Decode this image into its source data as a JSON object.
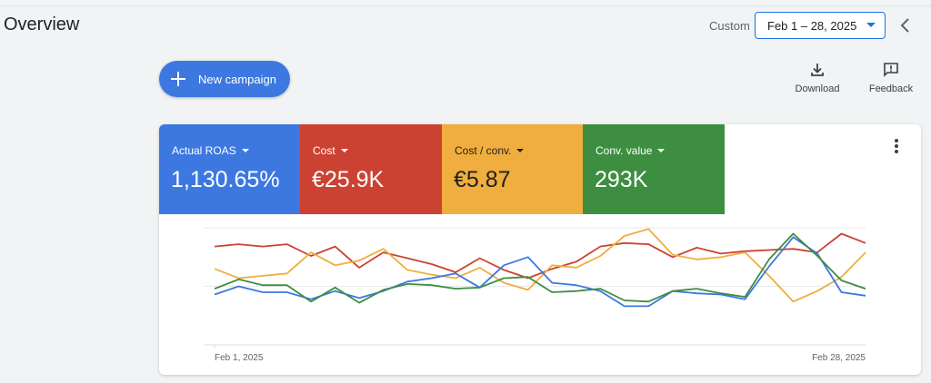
{
  "header": {
    "title": "Overview",
    "custom_label": "Custom",
    "date_range": "Feb 1 – 28, 2025"
  },
  "actions": {
    "new_campaign": "New campaign",
    "download": "Download",
    "feedback": "Feedback"
  },
  "metrics": [
    {
      "label": "Actual ROAS",
      "value": "1,130.65%",
      "color": "#3c78e0"
    },
    {
      "label": "Cost",
      "value": "€25.9K",
      "color": "#cc4232"
    },
    {
      "label": "Cost / conv.",
      "value": "€5.87",
      "color": "#efae3d"
    },
    {
      "label": "Conv. value",
      "value": "293K",
      "color": "#3e8e41"
    }
  ],
  "chart_data": {
    "type": "line",
    "x_tick_labels": [
      "Feb 1, 2025",
      "Feb 28, 2025"
    ],
    "x": [
      1,
      2,
      3,
      4,
      5,
      6,
      7,
      8,
      9,
      10,
      11,
      12,
      13,
      14,
      15,
      16,
      17,
      18,
      19,
      20,
      21,
      22,
      23,
      24,
      25,
      26,
      27,
      28
    ],
    "grid": true,
    "legend": "none",
    "series": [
      {
        "color": "#cc4232",
        "values": [
          84,
          86,
          84,
          86,
          76,
          84,
          66,
          79,
          74,
          69,
          62,
          74,
          64,
          57,
          65,
          71,
          84,
          87,
          86,
          75,
          83,
          78,
          80,
          81,
          82,
          79,
          95,
          87
        ]
      },
      {
        "color": "#efae3d",
        "values": [
          65,
          57,
          59,
          61,
          79,
          68,
          72,
          82,
          64,
          60,
          57,
          66,
          53,
          47,
          68,
          66,
          76,
          93,
          99,
          77,
          73,
          75,
          79,
          59,
          37,
          46,
          58,
          79
        ]
      },
      {
        "color": "#3c78e0",
        "values": [
          43,
          50,
          45,
          45,
          39,
          46,
          40,
          46,
          54,
          57,
          61,
          49,
          68,
          75,
          53,
          51,
          46,
          33,
          33,
          46,
          44,
          43,
          39,
          67,
          92,
          78,
          45,
          42
        ]
      },
      {
        "color": "#3e8e41",
        "values": [
          48,
          56,
          51,
          51,
          37,
          49,
          36,
          47,
          52,
          51,
          48,
          49,
          57,
          58,
          45,
          46,
          48,
          38,
          37,
          46,
          48,
          44,
          41,
          73,
          95,
          76,
          55,
          48
        ]
      }
    ]
  }
}
